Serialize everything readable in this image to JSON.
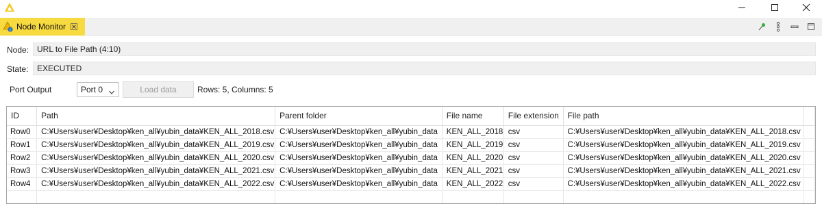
{
  "titlebar": {
    "app_icon": "knime-triangle-icon",
    "controls": [
      "minimize-icon",
      "maximize-icon",
      "close-icon"
    ]
  },
  "tab": {
    "label": "Node Monitor",
    "icon": "node-monitor-icon",
    "close_icon": "tab-close-icon"
  },
  "toolbar_icons": [
    "pin-icon",
    "view-menu-icon",
    "minimize-view-icon",
    "maximize-view-icon"
  ],
  "node": {
    "label": "Node:",
    "value": "URL to File Path  (4:10)"
  },
  "state": {
    "label": "State:",
    "value": "EXECUTED"
  },
  "port": {
    "label": "Port Output",
    "selected": "Port 0",
    "load_button": "Load data",
    "rows_info": "Rows: 5, Columns: 5"
  },
  "table": {
    "columns": [
      "ID",
      "Path",
      "Parent folder",
      "File name",
      "File extension",
      "File path"
    ],
    "rows": [
      [
        "Row0",
        "C:¥Users¥user¥Desktop¥ken_all¥yubin_data¥KEN_ALL_2018.csv",
        "C:¥Users¥user¥Desktop¥ken_all¥yubin_data",
        "KEN_ALL_2018",
        "csv",
        "C:¥Users¥user¥Desktop¥ken_all¥yubin_data¥KEN_ALL_2018.csv"
      ],
      [
        "Row1",
        "C:¥Users¥user¥Desktop¥ken_all¥yubin_data¥KEN_ALL_2019.csv",
        "C:¥Users¥user¥Desktop¥ken_all¥yubin_data",
        "KEN_ALL_2019",
        "csv",
        "C:¥Users¥user¥Desktop¥ken_all¥yubin_data¥KEN_ALL_2019.csv"
      ],
      [
        "Row2",
        "C:¥Users¥user¥Desktop¥ken_all¥yubin_data¥KEN_ALL_2020.csv",
        "C:¥Users¥user¥Desktop¥ken_all¥yubin_data",
        "KEN_ALL_2020",
        "csv",
        "C:¥Users¥user¥Desktop¥ken_all¥yubin_data¥KEN_ALL_2020.csv"
      ],
      [
        "Row3",
        "C:¥Users¥user¥Desktop¥ken_all¥yubin_data¥KEN_ALL_2021.csv",
        "C:¥Users¥user¥Desktop¥ken_all¥yubin_data",
        "KEN_ALL_2021",
        "csv",
        "C:¥Users¥user¥Desktop¥ken_all¥yubin_data¥KEN_ALL_2021.csv"
      ],
      [
        "Row4",
        "C:¥Users¥user¥Desktop¥ken_all¥yubin_data¥KEN_ALL_2022.csv",
        "C:¥Users¥user¥Desktop¥ken_all¥yubin_data",
        "KEN_ALL_2022",
        "csv",
        "C:¥Users¥user¥Desktop¥ken_all¥yubin_data¥KEN_ALL_2022.csv"
      ]
    ]
  },
  "colors": {
    "tab_active": "#f7d940",
    "app_logo": "#f5c518"
  }
}
